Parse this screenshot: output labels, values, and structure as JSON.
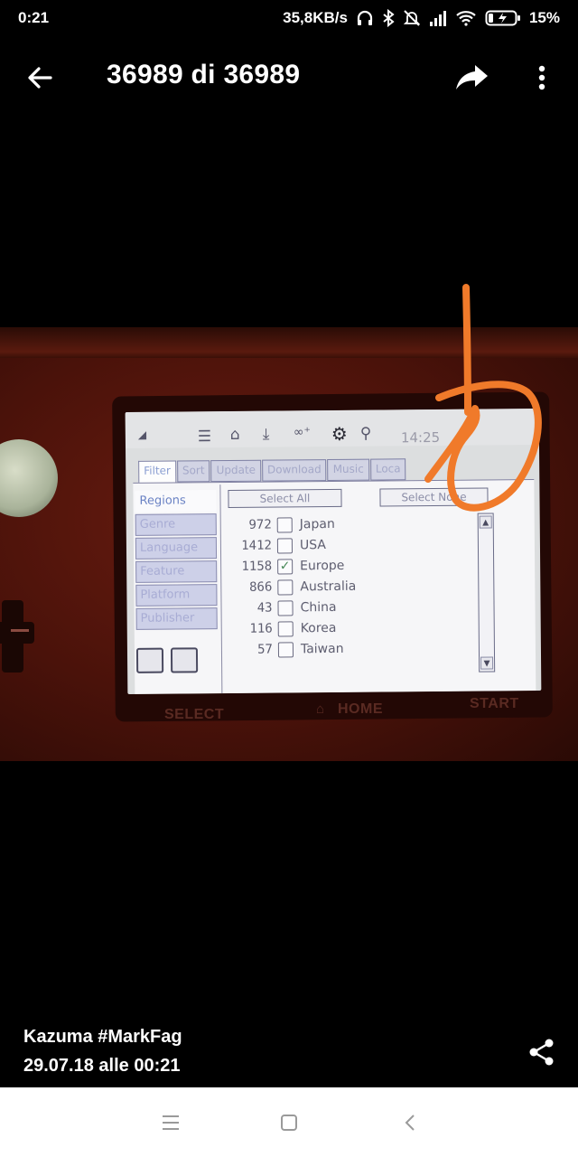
{
  "status_bar": {
    "time": "0:21",
    "net_speed": "35,8KB/s",
    "battery_percent": "15%",
    "icons": [
      "headphones-icon",
      "bluetooth-icon",
      "mute-icon",
      "signal-icon",
      "wifi-icon",
      "battery-charging-icon"
    ]
  },
  "app_bar": {
    "counter": "36989 di 36989",
    "icons": [
      "back-arrow-icon",
      "share-forward-icon",
      "more-vert-icon"
    ]
  },
  "photo": {
    "device_screen": {
      "clock": "14:25",
      "tabs": [
        "Filter",
        "Sort",
        "Update",
        "Download",
        "Music",
        "Loca"
      ],
      "active_tab": "Filter",
      "sidebar": [
        "Regions",
        "Genre",
        "Language",
        "Feature",
        "Platform",
        "Publisher"
      ],
      "active_sidebar": "Regions",
      "select_all": "Select All",
      "select_none": "Select None",
      "rows": [
        {
          "count": "972",
          "label": "Japan",
          "checked": false
        },
        {
          "count": "1412",
          "label": "USA",
          "checked": false
        },
        {
          "count": "1158",
          "label": "Europe",
          "checked": true
        },
        {
          "count": "866",
          "label": "Australia",
          "checked": false
        },
        {
          "count": "43",
          "label": "China",
          "checked": false
        },
        {
          "count": "116",
          "label": "Korea",
          "checked": false
        },
        {
          "count": "57",
          "label": "Taiwan",
          "checked": false
        }
      ]
    },
    "console_labels": {
      "select": "SELECT",
      "home": "HOME",
      "start": "START"
    },
    "annotation_color": "#f07a2a"
  },
  "caption": {
    "author": "Kazuma #MarkFag",
    "date": "29.07.18 alle 00:21"
  },
  "nav_bar": {
    "icons": [
      "menu-icon",
      "home-square-icon",
      "back-chevron-icon"
    ]
  }
}
